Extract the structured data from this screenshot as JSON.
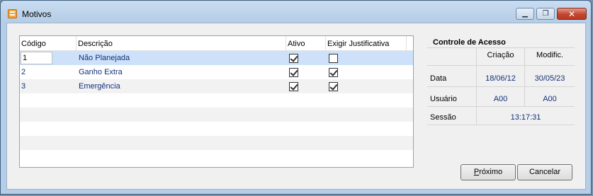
{
  "window": {
    "title": "Motivos",
    "minimize_glyph": "▁",
    "restore_glyph": "❐",
    "close_glyph": "✕"
  },
  "grid": {
    "columns": [
      "Código",
      "Descrição",
      "Ativo",
      "Exigir Justificativa"
    ],
    "rows": [
      {
        "code": "1",
        "description": "Não Planejada",
        "ativo": true,
        "exigir": false
      },
      {
        "code": "2",
        "description": "Ganho Extra",
        "ativo": true,
        "exigir": true
      },
      {
        "code": "3",
        "description": "Emergência",
        "ativo": true,
        "exigir": true
      }
    ]
  },
  "access": {
    "title": "Controle de Acesso",
    "col_creation": "Criação",
    "col_modified": "Modific.",
    "row_date": "Data",
    "row_user": "Usuário",
    "row_session": "Sessão",
    "date_created": "18/06/12",
    "date_modified": "30/05/23",
    "user_created": "A00",
    "user_modified": "A00",
    "session": "13:17:31"
  },
  "buttons": {
    "next": "Próximo",
    "cancel": "Cancelar"
  }
}
